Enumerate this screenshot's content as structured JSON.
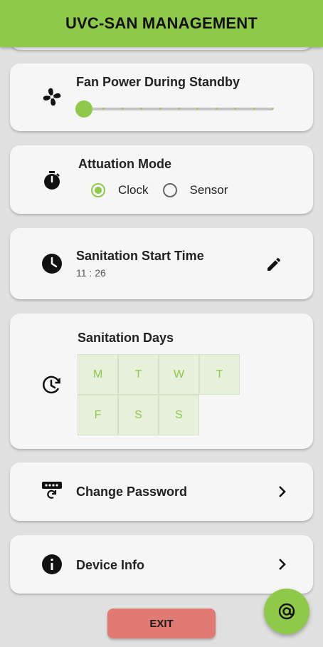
{
  "app": {
    "title": "UVC-SAN MANAGEMENT",
    "accent_color": "#8fc94a"
  },
  "fan_power": {
    "title": "Fan Power During Standby",
    "icon": "fan-icon",
    "slider_value": 0,
    "slider_steps": 11
  },
  "actuation": {
    "title": "Attuation Mode",
    "icon": "stopwatch-icon",
    "options": [
      {
        "label": "Clock",
        "selected": true
      },
      {
        "label": "Sensor",
        "selected": false
      }
    ]
  },
  "start_time": {
    "title": "Sanitation Start Time",
    "value": "11 : 26",
    "icon": "clock-icon",
    "edit_icon": "pencil-icon"
  },
  "days": {
    "title": "Sanitation Days",
    "icon": "history-icon",
    "items": [
      "M",
      "T",
      "W",
      "T",
      "F",
      "S",
      "S"
    ]
  },
  "password": {
    "title": "Change Password",
    "icon": "password-reset-icon"
  },
  "device": {
    "title": "Device Info",
    "icon": "info-icon"
  },
  "exit": {
    "label": "EXIT"
  },
  "fab": {
    "icon": "at-icon"
  }
}
